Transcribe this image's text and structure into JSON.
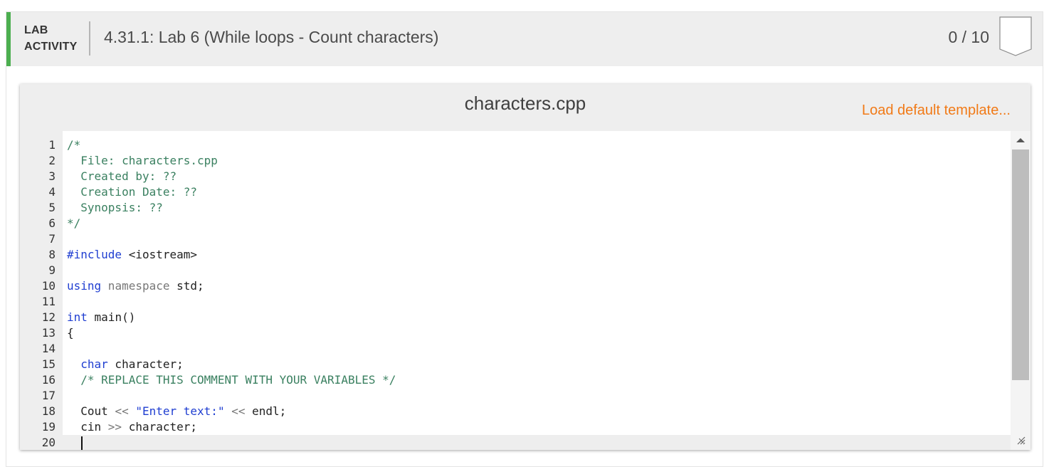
{
  "header": {
    "lab_label_line1": "LAB",
    "lab_label_line2": "ACTIVITY",
    "title": "4.31.1: Lab 6 (While loops - Count characters)",
    "score": "0 / 10",
    "accent_color": "#4caf50",
    "badge_icon": "completion-badge-icon"
  },
  "editor": {
    "filename": "characters.cpp",
    "load_template_label": "Load default template...",
    "link_color": "#f17a17",
    "lines": [
      {
        "n": "1",
        "tokens": [
          {
            "t": "/*",
            "c": "comment"
          }
        ]
      },
      {
        "n": "2",
        "tokens": [
          {
            "t": "  File: characters.cpp",
            "c": "comment"
          }
        ]
      },
      {
        "n": "3",
        "tokens": [
          {
            "t": "  Created by: ??",
            "c": "comment"
          }
        ]
      },
      {
        "n": "4",
        "tokens": [
          {
            "t": "  Creation Date: ??",
            "c": "comment"
          }
        ]
      },
      {
        "n": "5",
        "tokens": [
          {
            "t": "  Synopsis: ??",
            "c": "comment"
          }
        ]
      },
      {
        "n": "6",
        "tokens": [
          {
            "t": "*/",
            "c": "comment"
          }
        ]
      },
      {
        "n": "7",
        "tokens": []
      },
      {
        "n": "8",
        "tokens": [
          {
            "t": "#include",
            "c": "keyword"
          },
          {
            "t": " <iostream>",
            "c": "plain"
          }
        ]
      },
      {
        "n": "9",
        "tokens": []
      },
      {
        "n": "10",
        "tokens": [
          {
            "t": "using",
            "c": "keyword"
          },
          {
            "t": " namespace",
            "c": "ns"
          },
          {
            "t": " std;",
            "c": "plain"
          }
        ]
      },
      {
        "n": "11",
        "tokens": []
      },
      {
        "n": "12",
        "tokens": [
          {
            "t": "int",
            "c": "keyword"
          },
          {
            "t": " main()",
            "c": "plain"
          }
        ]
      },
      {
        "n": "13",
        "tokens": [
          {
            "t": "{",
            "c": "plain"
          }
        ]
      },
      {
        "n": "14",
        "tokens": []
      },
      {
        "n": "15",
        "tokens": [
          {
            "t": "  ",
            "c": "plain"
          },
          {
            "t": "char",
            "c": "keyword"
          },
          {
            "t": " character;",
            "c": "plain"
          }
        ]
      },
      {
        "n": "16",
        "tokens": [
          {
            "t": "  /* REPLACE THIS COMMENT WITH YOUR VARIABLES */",
            "c": "comment"
          }
        ]
      },
      {
        "n": "17",
        "tokens": []
      },
      {
        "n": "18",
        "tokens": [
          {
            "t": "  Cout ",
            "c": "plain"
          },
          {
            "t": "<<",
            "c": "op"
          },
          {
            "t": " ",
            "c": "plain"
          },
          {
            "t": "\"Enter text:\"",
            "c": "string"
          },
          {
            "t": " ",
            "c": "plain"
          },
          {
            "t": "<<",
            "c": "op"
          },
          {
            "t": " endl;",
            "c": "plain"
          }
        ]
      },
      {
        "n": "19",
        "tokens": [
          {
            "t": "  cin ",
            "c": "plain"
          },
          {
            "t": ">>",
            "c": "op"
          },
          {
            "t": " character;",
            "c": "plain"
          }
        ]
      },
      {
        "n": "20",
        "tokens": [],
        "active": true
      }
    ]
  }
}
